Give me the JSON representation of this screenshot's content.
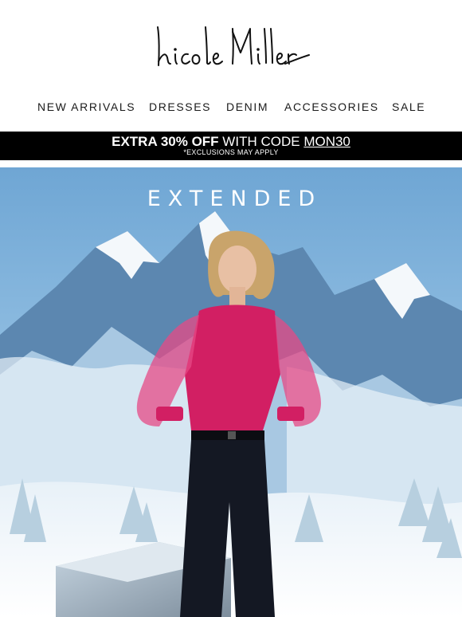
{
  "brand": {
    "logo_text": "Nicole Miller",
    "logo_icon": "nicole-miller-script-logo"
  },
  "nav": {
    "items": [
      {
        "label": "NEW ARRIVALS"
      },
      {
        "label": "DRESSES"
      },
      {
        "label": "DENIM"
      },
      {
        "label": "ACCESSORIES"
      },
      {
        "label": "SALE"
      }
    ]
  },
  "promo": {
    "bold_text": "EXTRA 30% OFF",
    "text": "WITH CODE",
    "code": "MON30",
    "note": "*EXCLUSIONS MAY APPLY",
    "background": "#000000",
    "color": "#ffffff"
  },
  "hero": {
    "title": "EXTENDED",
    "image": "model-in-pink-sweater-snowy-mountains",
    "colors": {
      "sky": "#7fb2d9",
      "sweater": "#d21f63",
      "pants": "#141823"
    }
  }
}
